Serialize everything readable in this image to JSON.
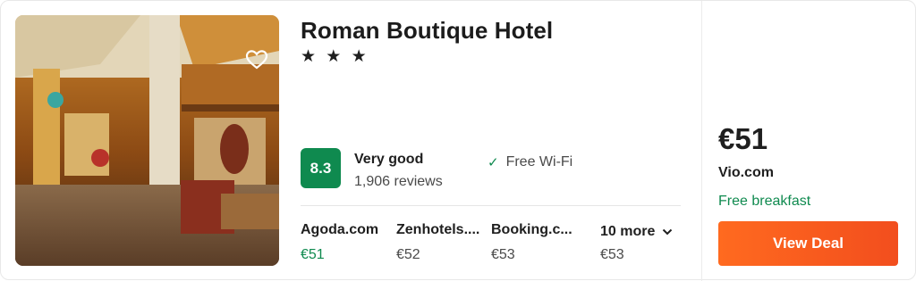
{
  "hotel": {
    "name": "Roman Boutique Hotel",
    "stars": "★ ★ ★",
    "score": "8.3",
    "rating_label": "Very good",
    "reviews": "1,906 reviews",
    "amenity": "Free Wi-Fi",
    "amenity_icon": "check-icon",
    "favorite_icon": "heart-icon"
  },
  "providers": [
    {
      "name": "Agoda.com",
      "price": "€51"
    },
    {
      "name": "Zenhotels....",
      "price": "€52"
    },
    {
      "name": "Booking.c...",
      "price": "€53"
    }
  ],
  "more": {
    "label": "10 more",
    "price": "€53",
    "icon": "chevron-down-icon"
  },
  "deal": {
    "price": "€51",
    "site": "Vio.com",
    "perk": "Free breakfast",
    "button": "View Deal"
  },
  "colors": {
    "score_bg": "#0f8a4f",
    "accent_green": "#0f8a4f",
    "cta_orange": "#f95b1e"
  }
}
